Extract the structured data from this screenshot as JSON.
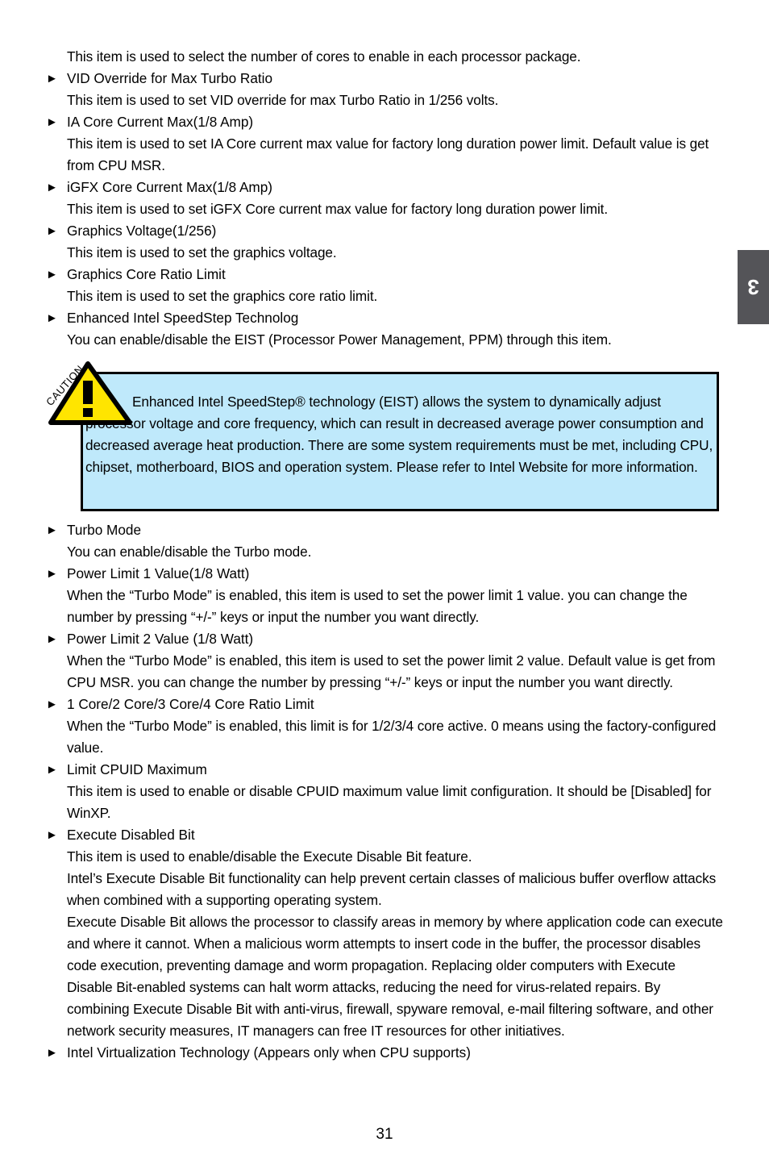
{
  "document": {
    "page_number": "31",
    "chapter_tab": "3",
    "chapter_tab_color": "#545458"
  },
  "caution": {
    "icon_label": "CAUTION",
    "icon_mark": "!",
    "background_color": "#bfe9fb",
    "border_color": "#000000",
    "text": "Enhanced Intel SpeedStep® technology (EIST) allows the system to dynamically adjust processor voltage and core frequency, which can result in decreased average power consumption and decreased average heat production. There are some system requirements must be met, including CPU, chipset, motherboard, BIOS and operation system. Please refer to Intel Website for more information."
  },
  "bullet_marker": "►",
  "blocks": [
    {
      "type": "paragraph",
      "text": "This item is used to select the number of cores to enable in each processor package."
    },
    {
      "type": "bullet",
      "label": "VID Override for Max Turbo Ratio"
    },
    {
      "type": "paragraph",
      "text": "This item is used to set VID override for max Turbo Ratio in 1/256 volts."
    },
    {
      "type": "bullet",
      "label": "IA Core Current Max(1/8 Amp)"
    },
    {
      "type": "paragraph",
      "text": "This item is used to set IA Core current max value for factory long duration power limit. Default value is get from CPU MSR."
    },
    {
      "type": "bullet",
      "label": "iGFX Core Current Max(1/8 Amp)"
    },
    {
      "type": "paragraph",
      "text": "This item is used to set iGFX Core current max value for factory long duration power limit."
    },
    {
      "type": "bullet",
      "label": "Graphics Voltage(1/256)"
    },
    {
      "type": "paragraph",
      "text": "This item is used to set the graphics voltage."
    },
    {
      "type": "bullet",
      "label": "Graphics Core Ratio Limit"
    },
    {
      "type": "paragraph",
      "text": "This item is used to set the graphics core ratio limit."
    },
    {
      "type": "bullet",
      "label": "Enhanced Intel SpeedStep Technolog"
    },
    {
      "type": "paragraph",
      "text": "You can enable/disable the EIST (Processor Power Management, PPM) through this item."
    },
    {
      "type": "caution"
    },
    {
      "type": "bullet",
      "label": "Turbo Mode"
    },
    {
      "type": "paragraph",
      "text": "You can enable/disable the Turbo mode."
    },
    {
      "type": "bullet",
      "label": "Power Limit 1 Value(1/8 Watt)"
    },
    {
      "type": "paragraph",
      "text": "When the “Turbo Mode” is enabled, this item is used to set the power limit 1 value. you can change the number by pressing “+/-” keys or input the number you want directly."
    },
    {
      "type": "bullet",
      "label": "Power Limit 2 Value (1/8 Watt)"
    },
    {
      "type": "paragraph",
      "text": "When the “Turbo Mode” is enabled, this item is used to set the power limit 2 value. Default value is get from CPU MSR. you can change the number by pressing “+/-” keys or input the number you want directly."
    },
    {
      "type": "bullet",
      "label": "1 Core/2 Core/3 Core/4 Core Ratio Limit"
    },
    {
      "type": "paragraph",
      "text": "When the “Turbo Mode” is enabled, this limit is for 1/2/3/4 core active. 0 means using the factory-configured value."
    },
    {
      "type": "bullet",
      "label": "Limit CPUID Maximum"
    },
    {
      "type": "paragraph",
      "text": "This item is used to enable or disable CPUID maximum value limit configuration. It should be [Disabled] for WinXP."
    },
    {
      "type": "bullet",
      "label": "Execute Disabled Bit"
    },
    {
      "type": "paragraph",
      "text": "This item is used to enable/disable the Execute Disable Bit feature."
    },
    {
      "type": "paragraph",
      "text": "Intel’s Execute Disable Bit functionality can help prevent certain classes of malicious buffer overflow attacks when combined with a supporting operating system."
    },
    {
      "type": "paragraph",
      "text": "Execute Disable Bit allows the processor to classify areas in memory by where application code can execute and where it cannot. When a malicious worm attempts to insert code in the buffer, the processor disables code execution, preventing damage and worm propagation. Replacing older computers with Execute Disable Bit-enabled systems can halt worm attacks, reducing the need for virus-related repairs. By combining Execute Disable Bit with anti-virus, firewall, spyware removal, e-mail filtering software, and other network security measures, IT managers can free IT resources for other initiatives."
    },
    {
      "type": "bullet",
      "label": "Intel Virtualization Technology (Appears only when CPU supports)"
    }
  ]
}
